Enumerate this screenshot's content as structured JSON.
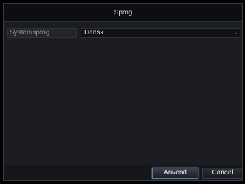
{
  "dialog": {
    "title": "Sprog"
  },
  "setting": {
    "label": "Systemsprog",
    "selected_value": "Dansk",
    "dropdown_icon": "chevron-down-icon"
  },
  "footer": {
    "apply_label": "Anvend",
    "cancel_label": "Cancel"
  },
  "colors": {
    "background": "#1b1d22",
    "titlebar": "#0d0e12",
    "apply_highlight": "#8fa0bd"
  }
}
